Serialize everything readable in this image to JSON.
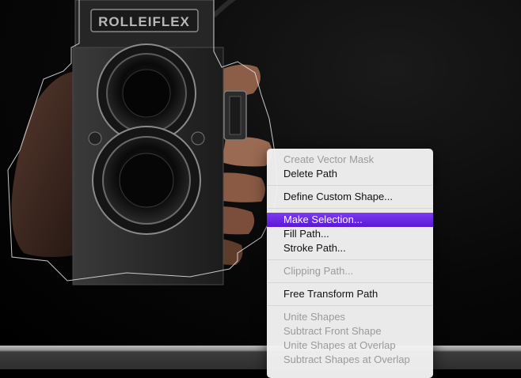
{
  "menu": {
    "groups": [
      {
        "items": [
          {
            "label": "Create Vector Mask",
            "enabled": false
          },
          {
            "label": "Delete Path",
            "enabled": true
          }
        ]
      },
      {
        "items": [
          {
            "label": "Define Custom Shape...",
            "enabled": true
          }
        ]
      },
      {
        "items": [
          {
            "label": "Make Selection...",
            "enabled": true,
            "highlighted": true
          },
          {
            "label": "Fill Path...",
            "enabled": true
          },
          {
            "label": "Stroke Path...",
            "enabled": true
          }
        ]
      },
      {
        "items": [
          {
            "label": "Clipping Path...",
            "enabled": false
          }
        ]
      },
      {
        "items": [
          {
            "label": "Free Transform Path",
            "enabled": true
          }
        ]
      },
      {
        "items": [
          {
            "label": "Unite Shapes",
            "enabled": false
          },
          {
            "label": "Subtract Front Shape",
            "enabled": false
          },
          {
            "label": "Unite Shapes at Overlap",
            "enabled": false
          },
          {
            "label": "Subtract Shapes at Overlap",
            "enabled": false
          }
        ]
      }
    ],
    "highlight_color": "#6a28e4"
  },
  "photo": {
    "camera_brand": "ROLLEIFLEX"
  }
}
